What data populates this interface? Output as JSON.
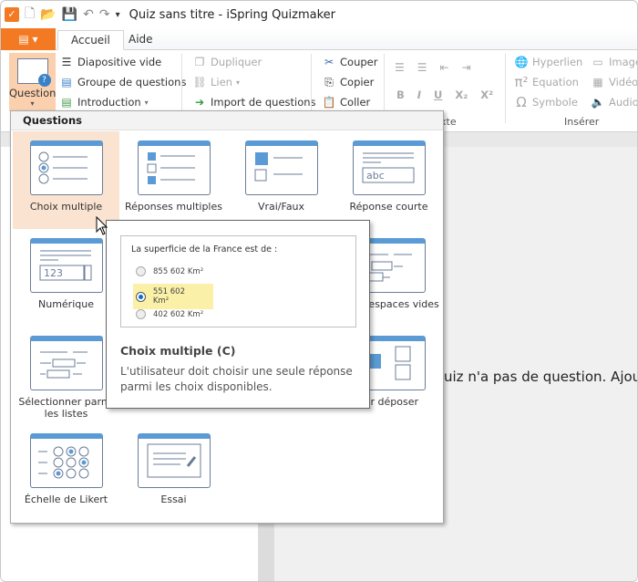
{
  "window": {
    "title": "Quiz sans titre - iSpring Quizmaker"
  },
  "tabs": [
    {
      "label": "Accueil",
      "active": true
    },
    {
      "label": "Aide"
    }
  ],
  "ribbon": {
    "question_button": "Question",
    "slides": [
      "Diapositive vide",
      "Groupe de questions",
      "Introduction"
    ],
    "edit": [
      "Dupliquer",
      "Lien",
      "Import de questions"
    ],
    "clipboard": [
      "Couper",
      "Copier",
      "Coller"
    ],
    "text_group_label": "xte",
    "insert": [
      "Hyperlien",
      "Equation",
      "Symbole"
    ],
    "media": [
      "Image",
      "Vidéo",
      "Audio"
    ],
    "insert_group_label": "Insérer",
    "text_format": [
      "B",
      "I",
      "U",
      "X₂",
      "X²"
    ]
  },
  "dropdown": {
    "header": "Questions",
    "items": [
      {
        "label": "Choix multiple",
        "icon": "multiple-choice-icon",
        "selected": true
      },
      {
        "label": "Réponses multiples",
        "icon": "multiple-response-icon"
      },
      {
        "label": "Vrai/Faux",
        "icon": "true-false-icon"
      },
      {
        "label": "Réponse courte",
        "icon": "short-answer-icon",
        "sample": "abc"
      },
      {
        "label": "Numérique",
        "icon": "numeric-icon",
        "sample": "123"
      },
      {
        "label": "lir les espaces vides",
        "icon": "fill-blanks-icon"
      },
      {
        "label": "Sélectionner parmi les listes",
        "icon": "select-from-lists-icon"
      },
      {
        "label": "ser déposer",
        "icon": "drag-drop-icon"
      },
      {
        "label": "Échelle de Likert",
        "icon": "likert-scale-icon"
      },
      {
        "label": "Essai",
        "icon": "essay-icon"
      }
    ]
  },
  "tooltip": {
    "question": "La superficie de la France est de :",
    "options": [
      {
        "label": "855 602 Km²"
      },
      {
        "label": "551 602 Km²",
        "selected": true
      },
      {
        "label": "402 602 Km²"
      }
    ],
    "title": "Choix multiple (C)",
    "description": "L'utilisateur doit choisir une seule réponse parmi les choix disponibles."
  },
  "canvas": {
    "message": "uiz n'a pas de question. Ajouter"
  },
  "colors": {
    "accent": "#f37a22",
    "highlight": "#fae3d0",
    "icon_blue": "#5b9bd5",
    "selected_option": "#fbf0a8"
  }
}
